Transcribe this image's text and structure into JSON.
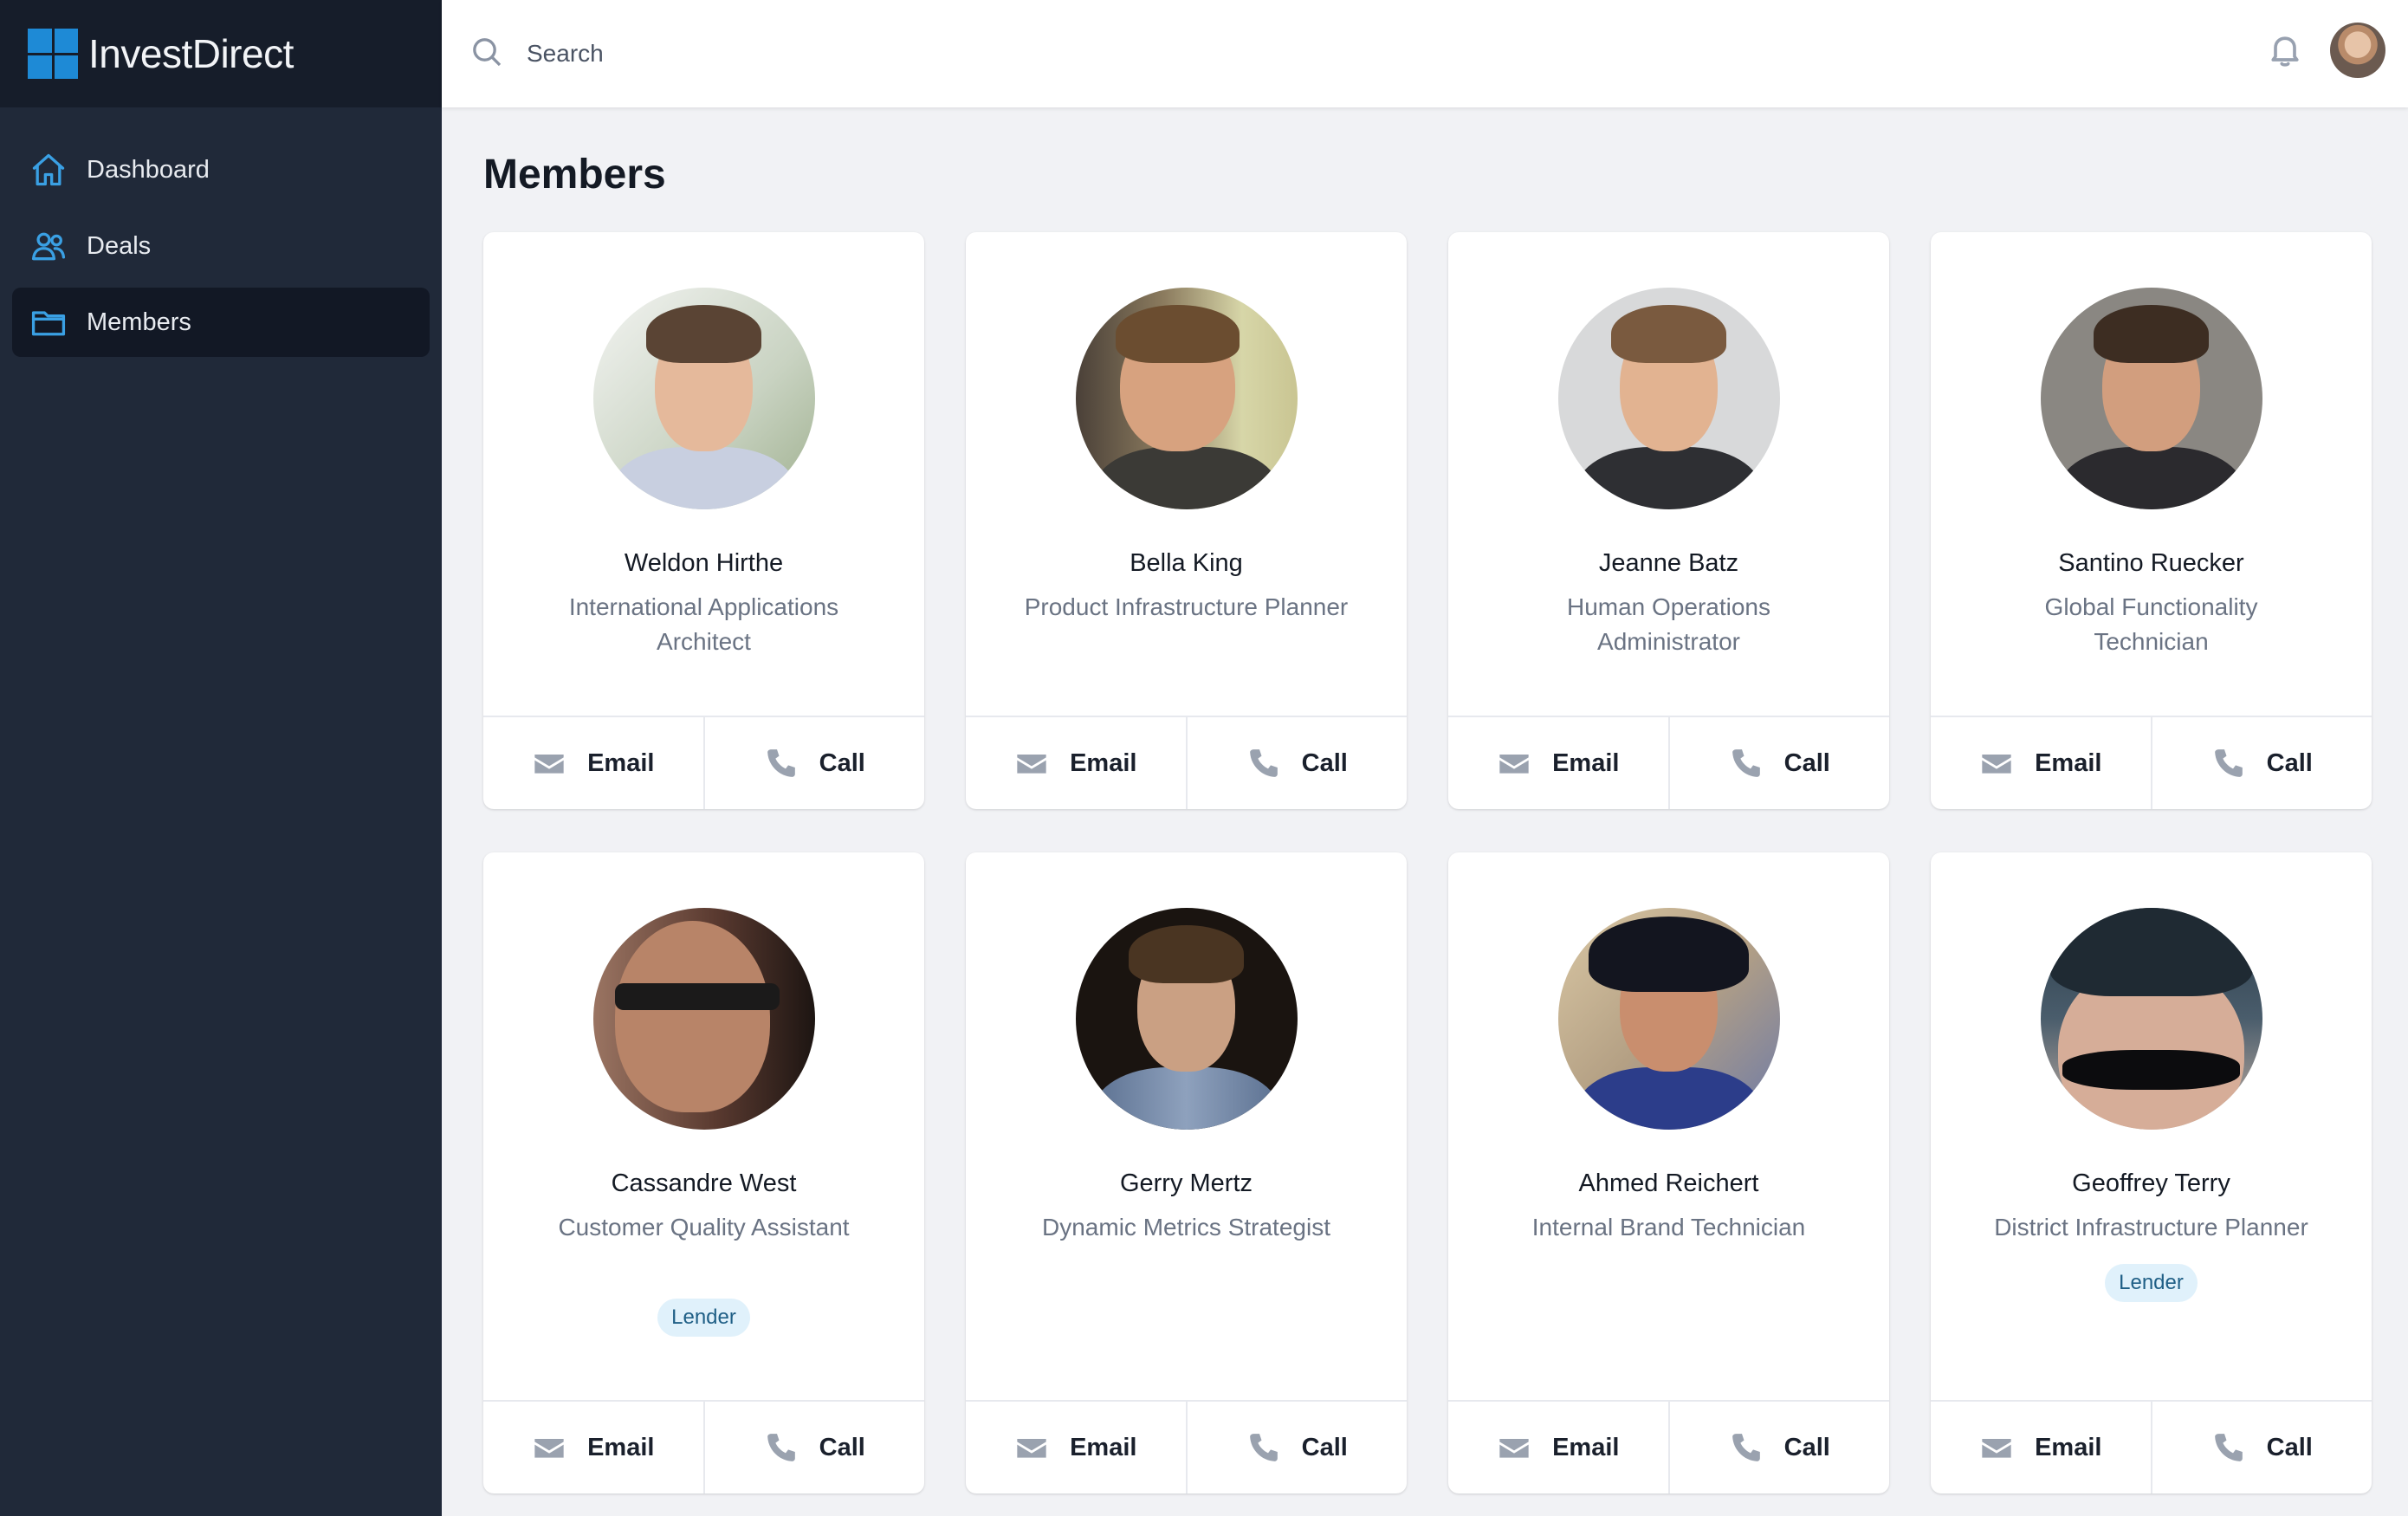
{
  "app": {
    "name": "InvestDirect"
  },
  "sidebar": {
    "items": [
      {
        "label": "Dashboard",
        "icon": "home-icon",
        "active": false
      },
      {
        "label": "Deals",
        "icon": "users-icon",
        "active": false
      },
      {
        "label": "Members",
        "icon": "folder-icon",
        "active": true
      }
    ]
  },
  "topbar": {
    "search_placeholder": "Search",
    "icons": [
      "search-icon",
      "bell-icon"
    ]
  },
  "main": {
    "title": "Members",
    "actions": {
      "email_label": "Email",
      "call_label": "Call"
    },
    "members": [
      {
        "name": "Weldon Hirthe",
        "role": "International Applications Architect",
        "badge": ""
      },
      {
        "name": "Bella King",
        "role": "Product Infrastructure Planner",
        "badge": ""
      },
      {
        "name": "Jeanne Batz",
        "role": "Human Operations Administrator",
        "badge": ""
      },
      {
        "name": "Santino Ruecker",
        "role": "Global Functionality Technician",
        "badge": ""
      },
      {
        "name": "Cassandre West",
        "role": "Customer Quality Assistant",
        "badge": "Lender"
      },
      {
        "name": "Gerry Mertz",
        "role": "Dynamic Metrics Strategist",
        "badge": ""
      },
      {
        "name": "Ahmed Reichert",
        "role": "Internal Brand Technician",
        "badge": ""
      },
      {
        "name": "Geoffrey Terry",
        "role": "District Infrastructure Planner",
        "badge": "Lender"
      }
    ]
  },
  "colors": {
    "sidebar_bg": "#202939",
    "brand_bg": "#161d2a",
    "accent": "#3aa0e4",
    "page_bg": "#f1f2f5",
    "badge_bg": "#e0f1fb",
    "badge_text": "#1f5f86"
  }
}
